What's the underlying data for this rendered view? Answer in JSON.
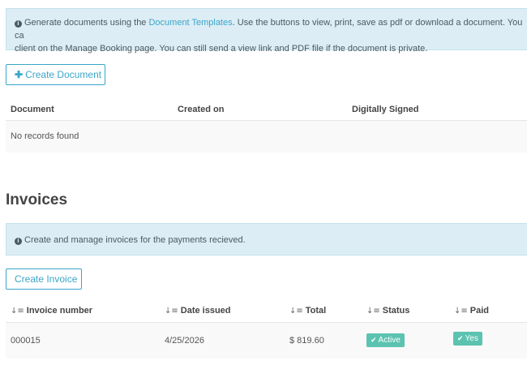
{
  "documents": {
    "alert": {
      "text_before_link": "Generate documents using the ",
      "link": "Document Templates",
      "text_after_link": ". Use the buttons to view, print, save as pdf or download a document. You ca",
      "line2": "client on the Manage Booking page. You can still send a view link and PDF file if the document is private."
    },
    "create_button": "Create Document",
    "columns": [
      "Document",
      "Created on",
      "Digitally Signed"
    ],
    "empty_message": "No records found"
  },
  "invoices": {
    "title": "Invoices",
    "alert": "Create and manage invoices for the payments recieved.",
    "create_button": "Create Invoice",
    "columns": [
      "Invoice number",
      "Date issued",
      "Total",
      "Status",
      "Paid"
    ],
    "rows": [
      {
        "invoice_number": "000015",
        "date_issued": "4/25/2026",
        "total": "$ 819.60",
        "status": "Active",
        "paid": "Yes"
      }
    ]
  },
  "colors": {
    "accent": "#3aa6c9",
    "alert_bg": "#dcedf5",
    "badge": "#5cc3b0"
  },
  "icons": {
    "info": "info-circle-icon",
    "plus": "plus-icon",
    "sort": "sort-icon",
    "check": "check-icon"
  }
}
